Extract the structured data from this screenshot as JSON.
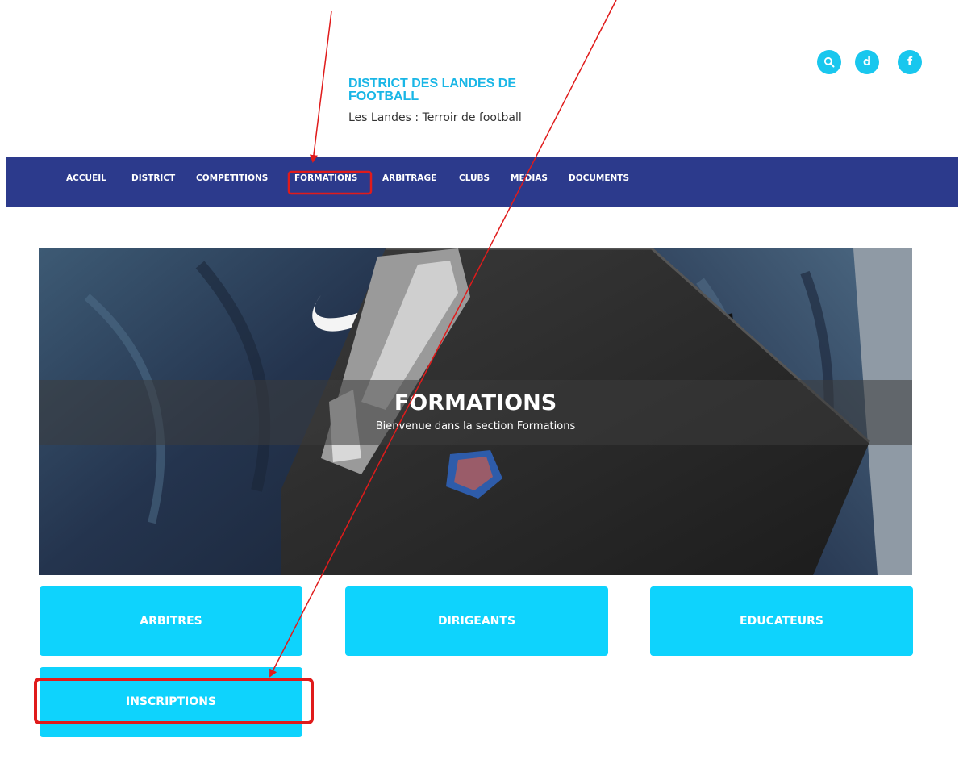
{
  "header": {
    "brand_title": "DISTRICT DES LANDES DE FOOTBALL",
    "brand_subtitle": "Les Landes : Terroir de football",
    "social": [
      {
        "icon": "search-icon",
        "label": ""
      },
      {
        "icon": "letter-d-icon",
        "label": "d"
      },
      {
        "icon": "facebook-icon",
        "label": "f"
      }
    ]
  },
  "nav": {
    "items": [
      {
        "label": "ACCUEIL"
      },
      {
        "label": "DISTRICT"
      },
      {
        "label": "COMPÉTITIONS"
      },
      {
        "label": "FORMATIONS"
      },
      {
        "label": "ARBITRAGE"
      },
      {
        "label": "CLUBS"
      },
      {
        "label": "MEDIAS"
      },
      {
        "label": "DOCUMENTS"
      }
    ]
  },
  "hero": {
    "title": "FORMATIONS",
    "subtitle": "Bienvenue dans la section Formations"
  },
  "tiles": [
    {
      "label": "ARBITRES"
    },
    {
      "label": "DIRIGEANTS"
    },
    {
      "label": "EDUCATEURS"
    },
    {
      "label": "INSCRIPTIONS"
    }
  ],
  "colors": {
    "nav_bg": "#2c3a8c",
    "accent": "#19c7ee",
    "tile_bg": "#0ed3fd",
    "annotation": "#e01b1b"
  }
}
